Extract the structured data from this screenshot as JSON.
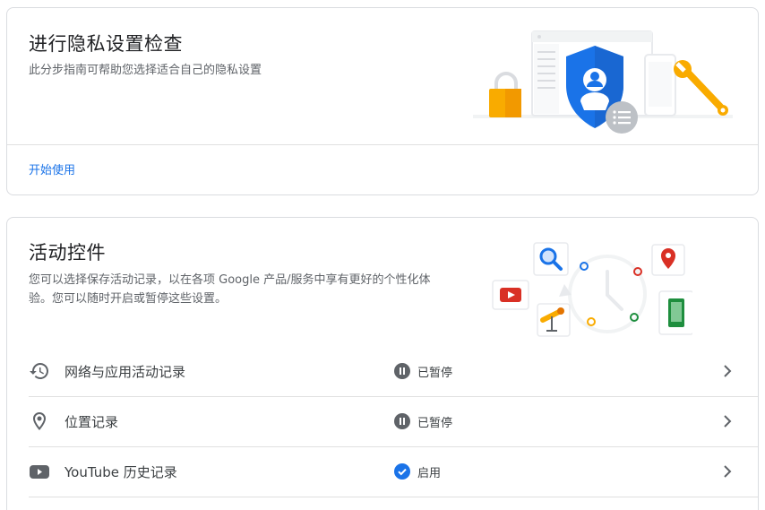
{
  "privacy_checkup": {
    "title": "进行隐私设置检查",
    "description": "此分步指南可帮助您选择适合自己的隐私设置",
    "start_link": "开始使用"
  },
  "activity_controls": {
    "title": "活动控件",
    "description": "您可以选择保存活动记录，以在各项 Google 产品/服务中享有更好的个性化体验。您可以随时开启或暂停这些设置。",
    "items": [
      {
        "label": "网络与应用活动记录",
        "icon": "history-icon",
        "status": "已暂停",
        "status_icon": "pause-icon"
      },
      {
        "label": "位置记录",
        "icon": "location-pin-icon",
        "status": "已暂停",
        "status_icon": "pause-icon"
      },
      {
        "label": "YouTube 历史记录",
        "icon": "youtube-icon",
        "status": "启用",
        "status_icon": "check-circle-icon"
      }
    ]
  },
  "colors": {
    "link": "#1a73e8",
    "paused": "#5f6368",
    "enabled": "#1a73e8",
    "shield": "#1a73e8",
    "lock": "#f9ab00"
  }
}
